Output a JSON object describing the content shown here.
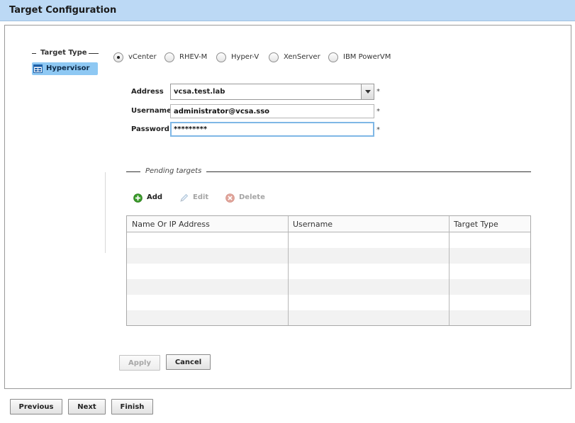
{
  "window": {
    "title": "Target Configuration"
  },
  "target_type": {
    "legend": "Target Type",
    "selected_item": {
      "label": "Hypervisor",
      "icon": "hypervisor-icon"
    }
  },
  "platforms": [
    {
      "label": "vCenter",
      "selected": true
    },
    {
      "label": "RHEV-M",
      "selected": false
    },
    {
      "label": "Hyper-V",
      "selected": false
    },
    {
      "label": "XenServer",
      "selected": false
    },
    {
      "label": "IBM PowerVM",
      "selected": false
    }
  ],
  "form": {
    "address": {
      "label": "Address",
      "value": "vcsa.test.lab"
    },
    "username": {
      "label": "Username",
      "value": "administrator@vcsa.sso"
    },
    "password": {
      "label": "Password",
      "value": "*********"
    },
    "required_marker": "*"
  },
  "pending": {
    "legend": "Pending targets",
    "toolbar": {
      "add_label": "Add",
      "edit_label": "Edit",
      "delete_label": "Delete"
    },
    "columns": [
      "Name Or IP Address",
      "Username",
      "Target Type"
    ],
    "rows": []
  },
  "actions": {
    "apply_label": "Apply",
    "cancel_label": "Cancel"
  },
  "wizard": {
    "previous_label": "Previous",
    "next_label": "Next",
    "finish_label": "Finish"
  },
  "colors": {
    "titlebar": "#bcd9f5",
    "selected_item": "#8ec8f3",
    "focus_border": "#7fb7e6",
    "add_icon": "#3a9a2a",
    "delete_icon": "#e0a49a"
  }
}
